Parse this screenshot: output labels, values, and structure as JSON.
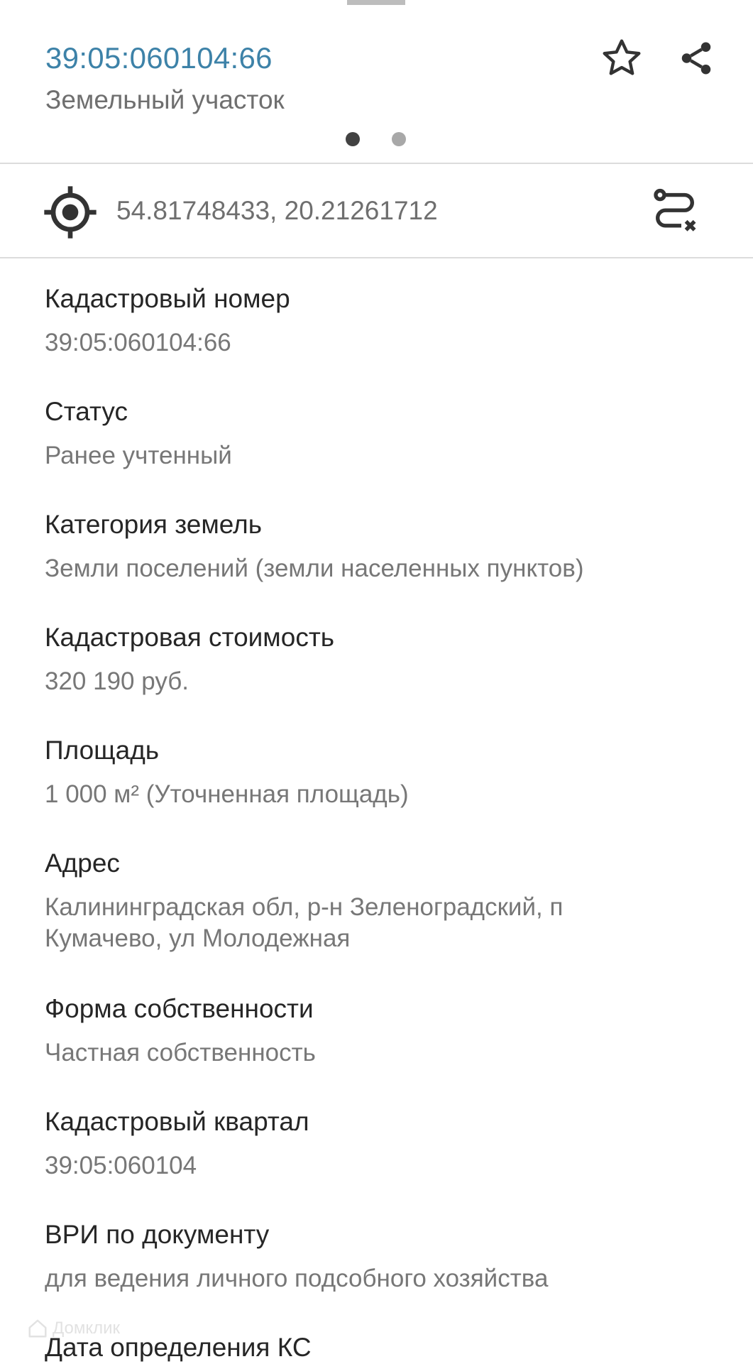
{
  "header": {
    "title": "39:05:060104:66",
    "subtitle": "Земельный участок",
    "pager": {
      "count": 2,
      "active": 1
    }
  },
  "icons": {
    "favorite": "star-outline-icon",
    "share": "share-icon",
    "location": "crosshair-gps-icon",
    "route": "route-clear-icon"
  },
  "location": {
    "coordinates": "54.81748433, 20.21261712"
  },
  "properties": [
    {
      "label": "Кадастровый номер",
      "value": "39:05:060104:66"
    },
    {
      "label": "Статус",
      "value": "Ранее учтенный"
    },
    {
      "label": "Категория земель",
      "value": "Земли поселений (земли населенных пунктов)"
    },
    {
      "label": "Кадастровая стоимость",
      "value": "320 190 руб."
    },
    {
      "label": "Площадь",
      "value": "1 000 м² (Уточненная площадь)"
    },
    {
      "label": "Адрес",
      "value": "Калининградская обл, р-н Зеленоградский, п Кумачево,  ул Молодежная"
    },
    {
      "label": "Форма собственности",
      "value": "Частная собственность"
    },
    {
      "label": "Кадастровый квартал",
      "value": "39:05:060104"
    },
    {
      "label": "ВРИ по документу",
      "value": "для ведения личного подсобного хозяйства"
    },
    {
      "label": "Дата определения КС",
      "value": ""
    }
  ],
  "watermark": "Домклик",
  "colors": {
    "title": "#3d82a8",
    "label": "#262626",
    "value": "#777777",
    "divider": "#dcdcdc"
  }
}
